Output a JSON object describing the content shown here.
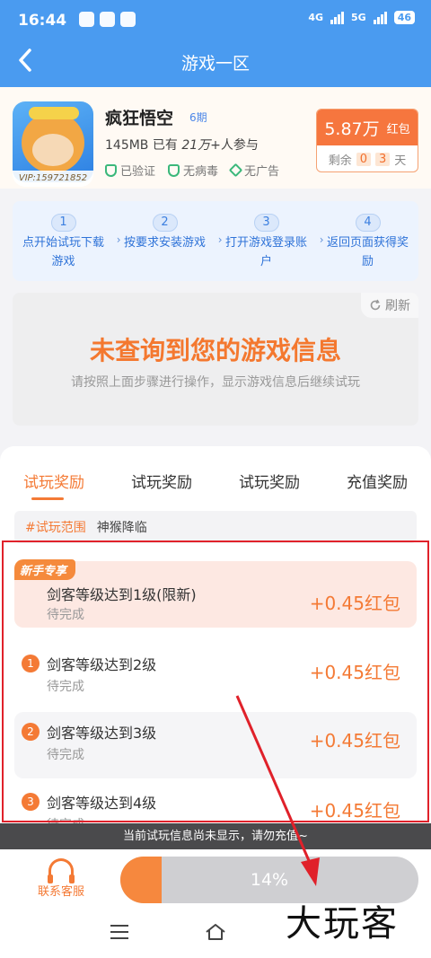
{
  "status_bar": {
    "time": "16:44",
    "network": "4G",
    "network2": "5G",
    "battery": "46"
  },
  "header": {
    "title": "游戏一区"
  },
  "game": {
    "name": "疯狂悟空",
    "period": "6期",
    "meta": "145MB 已有",
    "meta_count": "21万+",
    "meta_suffix": "人参与",
    "vip": "VIP:159721852",
    "badges": [
      "已验证",
      "无病毒",
      "无广告"
    ]
  },
  "reward": {
    "amount": "5.87万",
    "unit": "红包",
    "remain_label": "剩余",
    "days": [
      "0",
      "3"
    ],
    "days_unit": "天"
  },
  "steps": [
    {
      "num": "1",
      "text": "点开始试玩下载游戏"
    },
    {
      "num": "2",
      "text": "按要求安装游戏"
    },
    {
      "num": "3",
      "text": "打开游戏登录账户"
    },
    {
      "num": "4",
      "text": "返回页面获得奖励"
    }
  ],
  "info_panel": {
    "refresh": "刷新",
    "title": "未查询到您的游戏信息",
    "subtitle": "请按照上面步骤进行操作，显示游戏信息后继续试玩"
  },
  "tabs": [
    "试玩奖励",
    "试玩奖励",
    "试玩奖励",
    "充值奖励"
  ],
  "range": {
    "tag": "#试玩范围",
    "value": "神猴降临"
  },
  "tasks": [
    {
      "tag": "新手专享",
      "name": "剑客等级达到1级(限新)",
      "status": "待完成",
      "reward": "+0.45红包"
    },
    {
      "num": "1",
      "name": "剑客等级达到2级",
      "status": "待完成",
      "reward": "+0.45红包"
    },
    {
      "num": "2",
      "name": "剑客等级达到3级",
      "status": "待完成",
      "reward": "+0.45红包"
    },
    {
      "num": "3",
      "name": "剑客等级达到4级",
      "status": "待完成",
      "reward": "+0.45红包"
    }
  ],
  "notice": "当前试玩信息尚未显示，请勿充值~",
  "bottom": {
    "service": "联系客服",
    "progress_text": "14%",
    "progress_value": 0.14
  },
  "watermark": "大玩客",
  "colors": {
    "primary": "#4a9bf0",
    "accent": "#f47a35",
    "highlight": "#e0212a"
  }
}
